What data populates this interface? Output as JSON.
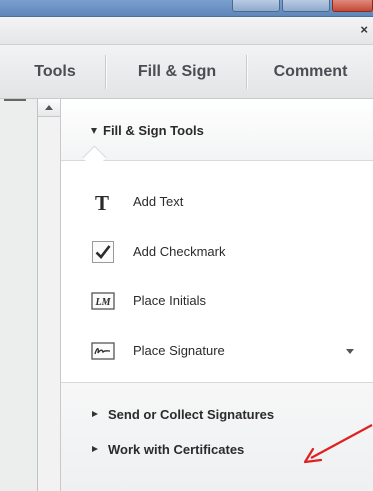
{
  "window": {
    "close_glyph": "×"
  },
  "tabs": [
    {
      "label": "Tools"
    },
    {
      "label": "Fill & Sign"
    },
    {
      "label": "Comment"
    }
  ],
  "panel": {
    "section_title": "Fill & Sign Tools",
    "tools": [
      {
        "label": "Add Text",
        "icon": "text-t-icon"
      },
      {
        "label": "Add Checkmark",
        "icon": "checkmark-icon"
      },
      {
        "label": "Place Initials",
        "icon": "initials-icon"
      },
      {
        "label": "Place Signature",
        "icon": "signature-icon",
        "has_dropdown": true
      }
    ],
    "collapsed_sections": [
      {
        "label": "Send or Collect Signatures"
      },
      {
        "label": "Work with Certificates"
      }
    ]
  },
  "icons": {
    "initials_text": "LM"
  },
  "colors": {
    "annotation_arrow": "#e02020",
    "titlebar": "#6b90c2"
  }
}
